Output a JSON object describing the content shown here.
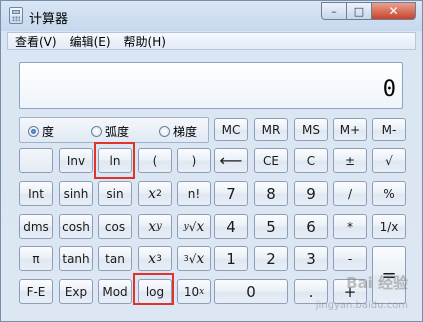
{
  "window": {
    "title": "计算器",
    "min": "–",
    "max": "□",
    "close": "✕"
  },
  "menu": [
    "查看(V)",
    "编辑(E)",
    "帮助(H)"
  ],
  "display": {
    "value": "0"
  },
  "modes": [
    {
      "label": "度",
      "selected": true
    },
    {
      "label": "弧度",
      "selected": false
    },
    {
      "label": "梯度",
      "selected": false
    }
  ],
  "buttons": {
    "mc": "MC",
    "mr": "MR",
    "ms": "MS",
    "mplus": "M+",
    "mminus": "M-",
    "blank": "",
    "inv": "Inv",
    "ln": "ln",
    "lparen": "(",
    "rparen": ")",
    "back": "⟵",
    "ce": "CE",
    "c": "C",
    "pm": "±",
    "sqrt": "√",
    "int": "Int",
    "sinh": "sinh",
    "sin": "sin",
    "x2_base": "x",
    "x2_exp": "2",
    "fact": "n!",
    "seven": "7",
    "eight": "8",
    "nine": "9",
    "div": "/",
    "pct": "%",
    "dms": "dms",
    "cosh": "cosh",
    "cos": "cos",
    "xy_base": "x",
    "xy_exp": "y",
    "yroot_idx": "y",
    "yroot_sym": "√",
    "yroot_x": "x",
    "four": "4",
    "five": "5",
    "six": "6",
    "mul": "*",
    "recip": "1/x",
    "pi": "π",
    "tanh": "tanh",
    "tan": "tan",
    "x3_base": "x",
    "x3_exp": "3",
    "croot_idx": "3",
    "croot_sym": "√",
    "croot_x": "x",
    "one": "1",
    "two": "2",
    "three": "3",
    "sub": "-",
    "eq": "=",
    "fe": "F-E",
    "exp": "Exp",
    "mod": "Mod",
    "log": "log",
    "ten_x_base": "10",
    "ten_x_exp": "x",
    "zero": "0",
    "dot": ".",
    "add": "+"
  },
  "watermark": {
    "brand": "Bai 经验",
    "url": "jingyan.baidu.com"
  },
  "colors": {
    "highlight": "#e0332b",
    "titlebar": "#c6d8ee"
  }
}
